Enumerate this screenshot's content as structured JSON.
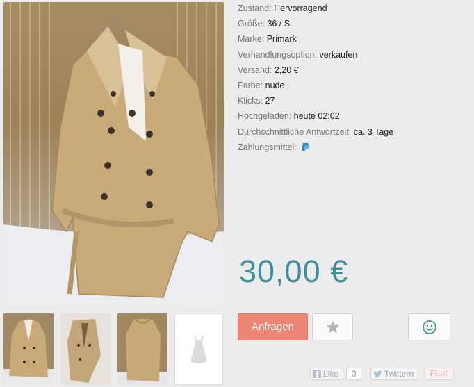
{
  "details": [
    {
      "label": "Zustand:",
      "value": "Hervorragend"
    },
    {
      "label": "Größe:",
      "value": "36 / S"
    },
    {
      "label": "Marke:",
      "value": "Primark"
    },
    {
      "label": "Verhandlungsoption:",
      "value": "verkaufen"
    },
    {
      "label": "Versand:",
      "value": "2,20 €"
    },
    {
      "label": "Farbe:",
      "value": "nude"
    },
    {
      "label": "Klicks:",
      "value": "27"
    },
    {
      "label": "Hochgeladen:",
      "value": "heute 02:02"
    },
    {
      "label": "Durchschnittliche Antwortzeit:",
      "value": "ca. 3 Tage"
    },
    {
      "label": "Zahlungsmittel:",
      "value": ""
    }
  ],
  "payment_icon": "paypal-icon",
  "price": "30,00 €",
  "actions": {
    "ask_label": "Anfragen",
    "favorite_icon": "star-icon",
    "smile_icon": "smiley-icon"
  },
  "social": {
    "like_label": "Like",
    "like_count": "0",
    "tweet_label": "Twittern",
    "pin_label": "Pinit"
  },
  "colors": {
    "price": "#3d8f9e",
    "ask_button": "#ec8575",
    "paypal": "#1f7fc4"
  }
}
